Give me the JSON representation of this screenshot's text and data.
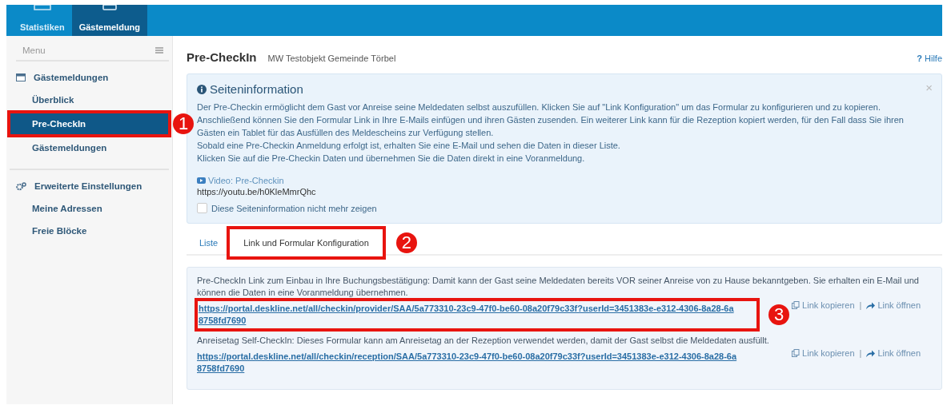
{
  "top_nav": [
    {
      "label": "Statistiken",
      "selected": false
    },
    {
      "label": "Gästemeldung",
      "selected": true
    }
  ],
  "sidebar": {
    "title": "Menu",
    "groups": [
      {
        "label": "Gästemeldungen",
        "items": [
          {
            "label": "Überblick",
            "selected": false
          },
          {
            "label": "Pre-CheckIn",
            "selected": true,
            "callout": "1"
          },
          {
            "label": "Gästemeldungen",
            "selected": false
          }
        ]
      },
      {
        "label": "Erweiterte Einstellungen",
        "items": [
          {
            "label": "Meine Adressen",
            "selected": false
          },
          {
            "label": "Freie Blöcke",
            "selected": false
          }
        ]
      }
    ]
  },
  "page": {
    "title": "Pre-CheckIn",
    "subtitle": "MW Testobjekt Gemeinde Törbel",
    "help_icon": "?",
    "help": "Hilfe"
  },
  "info": {
    "title": "Seiteninformation",
    "close": "×",
    "paragraphs": [
      "Der Pre-Checkin ermöglicht dem Gast vor Anreise seine Meldedaten selbst auszufüllen. Klicken Sie auf \"Link Konfiguration\" um das Formular zu konfigurieren und zu kopieren.",
      "Anschließend können Sie den Formular Link in Ihre E-Mails einfügen und ihren Gästen zusenden. Ein weiterer Link kann für die Rezeption kopiert werden, für den Fall dass Sie ihren Gästen ein Tablet für das Ausfüllen des Meldescheins zur Verfügung stellen.",
      "Sobald eine Pre-Checkin Anmeldung erfolgt ist, erhalten Sie eine E-Mail und sehen die Daten in dieser Liste.",
      "Klicken Sie auf die Pre-Checkin Daten und übernehmen Sie die Daten direkt in eine Voranmeldung."
    ],
    "video_label": "Video: Pre-Checkin",
    "video_url": "https://youtu.be/h0KleMmrQhc",
    "dont_show": {
      "label": "Diese Seiteninformation nicht mehr zeigen",
      "checked": false
    }
  },
  "tabs": [
    {
      "label": "Liste",
      "selected": false
    },
    {
      "label": "Link und Formular Konfiguration",
      "selected": true,
      "callout": "2"
    }
  ],
  "links": [
    {
      "description": "Pre-CheckIn Link zum Einbau in Ihre Buchungsbestätigung: Damit kann der Gast seine Meldedaten bereits VOR seiner Anreise von zu Hause bekanntgeben. Sie erhalten ein E-Mail und können die Daten in eine Voranmeldung übernehmen.",
      "url": "https://portal.deskline.net/all/checkin/provider/SAA/5a773310-23c9-47f0-be60-08a20f79c33f?userId=3451383e-e312-4306-8a28-6a8758fd7690",
      "copy": "Link kopieren",
      "separator": "|",
      "open": "Link öffnen",
      "callout": "3"
    },
    {
      "description": "Anreisetag Self-CheckIn: Dieses Formular kann am Anreisetag an der Rezeption verwendet werden, damit der Gast selbst die Meldedaten ausfüllt.",
      "url": "https://portal.deskline.net/all/checkin/reception/SAA/5a773310-23c9-47f0-be60-08a20f79c33f?userId=3451383e-e312-4306-8a28-6a8758fd7690",
      "copy": "Link kopieren",
      "separator": "|",
      "open": "Link öffnen"
    }
  ]
}
